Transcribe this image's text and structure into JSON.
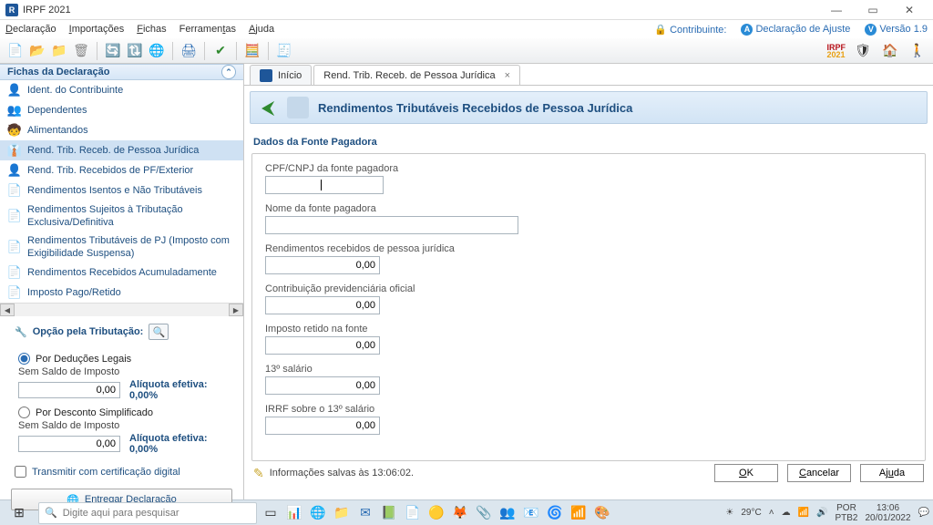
{
  "window": {
    "title": "IRPF 2021"
  },
  "menu": {
    "items": [
      "Declaração",
      "Importações",
      "Fichas",
      "Ferramentas",
      "Ajuda"
    ],
    "contribuinte_label": "Contribuinte:",
    "decl_ajuste": "Declaração de Ajuste",
    "versao": "Versão 1.9"
  },
  "logo": {
    "line1": "IRPF",
    "line2": "2021"
  },
  "sidebar": {
    "panel_title": "Fichas da Declaração",
    "items": [
      {
        "label": "Ident. do Contribuinte"
      },
      {
        "label": "Dependentes"
      },
      {
        "label": "Alimentandos"
      },
      {
        "label": "Rend. Trib. Receb. de Pessoa Jurídica"
      },
      {
        "label": "Rend. Trib. Recebidos de PF/Exterior"
      },
      {
        "label": "Rendimentos Isentos e Não Tributáveis"
      },
      {
        "label": "Rendimentos Sujeitos à Tributação Exclusiva/Definitiva"
      },
      {
        "label": "Rendimentos Tributáveis de PJ (Imposto com Exigibilidade Suspensa)"
      },
      {
        "label": "Rendimentos Recebidos Acumuladamente"
      },
      {
        "label": "Imposto Pago/Retido"
      }
    ],
    "opcao_title": "Opção pela Tributação:",
    "radio1": "Por Deduções Legais",
    "sub1": "Sem Saldo de Imposto",
    "val1": "0,00",
    "aliq1": "Alíquota efetiva: 0,00%",
    "radio2": "Por Desconto Simplificado",
    "sub2": "Sem Saldo de Imposto",
    "val2": "0,00",
    "aliq2": "Alíquota efetiva: 0,00%",
    "chk": "Transmitir com certificação digital",
    "deliver": "Entregar Declaração"
  },
  "tabs": {
    "t0": "Início",
    "t1": "Rend. Trib. Receb. de Pessoa Jurídica"
  },
  "page": {
    "title": "Rendimentos Tributáveis Recebidos de Pessoa Jurídica",
    "group": "Dados da Fonte Pagadora",
    "f_cpf": "CPF/CNPJ da fonte pagadora",
    "f_nome": "Nome da fonte pagadora",
    "f_rend": "Rendimentos recebidos de pessoa jurídica",
    "f_contrib": "Contribuição previdenciária oficial",
    "f_irrf": "Imposto retido na fonte",
    "f_13": "13º salário",
    "f_irrf13": "IRRF sobre o 13º salário",
    "v_rend": "0,00",
    "v_contrib": "0,00",
    "v_irrf": "0,00",
    "v_13": "0,00",
    "v_irrf13": "0,00"
  },
  "footer": {
    "info": "Informações salvas às 13:06:02.",
    "ok": "OK",
    "cancel": "Cancelar",
    "help": "Ajuda"
  },
  "taskbar": {
    "search_placeholder": "Digite aqui para pesquisar",
    "temp": "29°C",
    "lang1": "POR",
    "lang2": "PTB2",
    "time": "13:06",
    "date": "20/01/2022"
  }
}
